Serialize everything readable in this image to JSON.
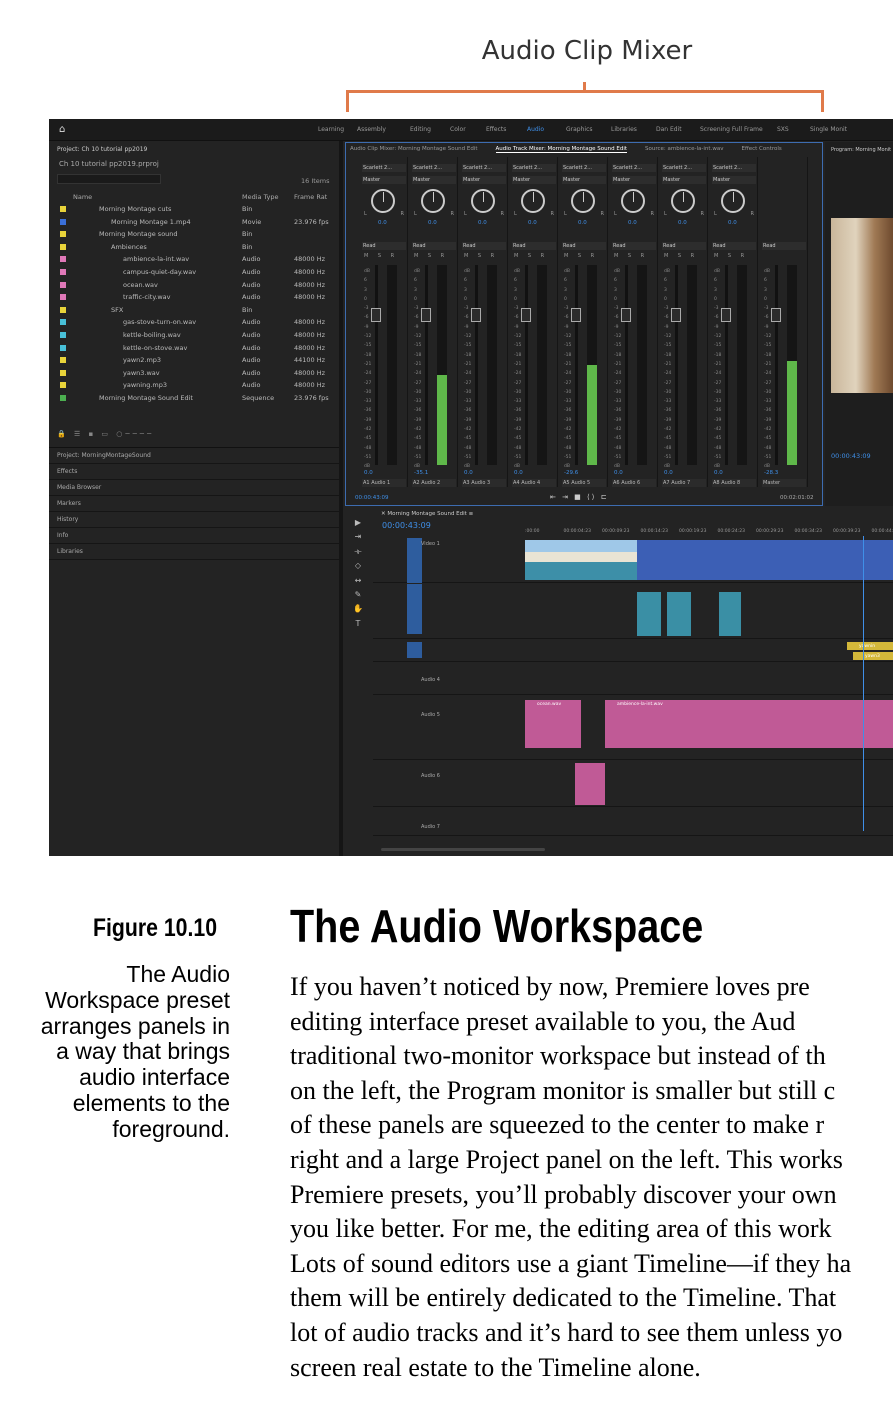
{
  "callout": {
    "title": "Audio Clip Mixer"
  },
  "app": {
    "workspaces": [
      "Learning",
      "Assembly",
      "Editing",
      "Color",
      "Effects",
      "Audio",
      "Graphics",
      "Libraries",
      "Dan Edit",
      "Screening Full Frame",
      "SXS",
      "Single Monit"
    ],
    "active_workspace": "Audio",
    "project": {
      "title": "Project: Ch 10 tutorial pp2019",
      "file": "Ch 10 tutorial pp2019.prproj",
      "item_count": "16 Items",
      "columns": [
        "Name",
        "Media Type",
        "Frame Rat"
      ],
      "rows": [
        {
          "name": "Morning Montage cuts",
          "type": "Bin",
          "rate": "",
          "color": "#e8d33a"
        },
        {
          "name": "Morning Montage 1.mp4",
          "type": "Movie",
          "rate": "23.976 fps",
          "color": "#3a6fd8"
        },
        {
          "name": "Morning Montage sound",
          "type": "Bin",
          "rate": "",
          "color": "#e8d33a"
        },
        {
          "name": "Ambiences",
          "type": "Bin",
          "rate": "",
          "color": "#e8d33a"
        },
        {
          "name": "ambience-la-int.wav",
          "type": "Audio",
          "rate": "48000 Hz",
          "color": "#e078b8"
        },
        {
          "name": "campus-quiet-day.wav",
          "type": "Audio",
          "rate": "48000 Hz",
          "color": "#e078b8"
        },
        {
          "name": "ocean.wav",
          "type": "Audio",
          "rate": "48000 Hz",
          "color": "#e078b8"
        },
        {
          "name": "traffic-city.wav",
          "type": "Audio",
          "rate": "48000 Hz",
          "color": "#e078b8"
        },
        {
          "name": "SFX",
          "type": "Bin",
          "rate": "",
          "color": "#e8d33a"
        },
        {
          "name": "gas-stove-turn-on.wav",
          "type": "Audio",
          "rate": "48000 Hz",
          "color": "#48c0d8"
        },
        {
          "name": "kettle-boiling.wav",
          "type": "Audio",
          "rate": "48000 Hz",
          "color": "#48c0d8"
        },
        {
          "name": "kettle-on-stove.wav",
          "type": "Audio",
          "rate": "48000 Hz",
          "color": "#48c0d8"
        },
        {
          "name": "yawn2.mp3",
          "type": "Audio",
          "rate": "44100 Hz",
          "color": "#e8d33a"
        },
        {
          "name": "yawn3.wav",
          "type": "Audio",
          "rate": "48000 Hz",
          "color": "#e8d33a"
        },
        {
          "name": "yawning.mp3",
          "type": "Audio",
          "rate": "48000 Hz",
          "color": "#e8d33a"
        },
        {
          "name": "Morning Montage Sound Edit",
          "type": "Sequence",
          "rate": "23.976 fps",
          "color": "#4caf50"
        }
      ]
    },
    "lower_panels": [
      "Project: MorningMontageSound",
      "Effects",
      "Media Browser",
      "Markers",
      "History",
      "Info",
      "Libraries"
    ],
    "mixer": {
      "tabs": [
        "Audio Clip Mixer: Morning Montage Sound Edit",
        "Audio Track Mixer: Morning Montage Sound Edit",
        "Source: ambience-la-int.wav",
        "Effect Controls"
      ],
      "active_tab": "Audio Track Mixer: Morning Montage Sound Edit",
      "channels": [
        {
          "name": "Scarlett 2...",
          "master": "Master",
          "pan": "0.0",
          "read": "Read",
          "vol": "0.0",
          "track": "A1",
          "track_name": "Audio 1",
          "level": 0
        },
        {
          "name": "Scarlett 2...",
          "master": "Master",
          "pan": "0.0",
          "read": "Read",
          "vol": "-35.1",
          "track": "A2",
          "track_name": "Audio 2",
          "level": 0.45
        },
        {
          "name": "Scarlett 2...",
          "master": "Master",
          "pan": "0.0",
          "read": "Read",
          "vol": "0.0",
          "track": "A3",
          "track_name": "Audio 3",
          "level": 0
        },
        {
          "name": "Scarlett 2...",
          "master": "Master",
          "pan": "0.0",
          "read": "Read",
          "vol": "0.0",
          "track": "A4",
          "track_name": "Audio 4",
          "level": 0
        },
        {
          "name": "Scarlett 2...",
          "master": "Master",
          "pan": "0.0",
          "read": "Read",
          "vol": "-29.6",
          "track": "A5",
          "track_name": "Audio 5",
          "level": 0.5
        },
        {
          "name": "Scarlett 2...",
          "master": "Master",
          "pan": "0.0",
          "read": "Read",
          "vol": "0.0",
          "track": "A6",
          "track_name": "Audio 6",
          "level": 0
        },
        {
          "name": "Scarlett 2...",
          "master": "Master",
          "pan": "0.0",
          "read": "Read",
          "vol": "0.0",
          "track": "A7",
          "track_name": "Audio 7",
          "level": 0
        },
        {
          "name": "Scarlett 2...",
          "master": "Master",
          "pan": "0.0",
          "read": "Read",
          "vol": "0.0",
          "track": "A8",
          "track_name": "Audio 8",
          "level": 0
        },
        {
          "name": "",
          "master": "",
          "pan": "",
          "read": "Read",
          "vol": "-28.3",
          "track": "",
          "track_name": "Master",
          "level": 0.52
        }
      ],
      "timecode_start": "00:00:43:09",
      "timecode_end": "00:02:01:02"
    },
    "program": {
      "title": "Program: Morning Monit",
      "timecode": "00:00:43:09"
    },
    "timeline": {
      "sequence": "Morning Montage Sound Edit",
      "timecode": "00:00:43:09",
      "ruler": [
        ":00:00",
        "00:00:04:23",
        "00:00:09:23",
        "00:00:14:23",
        "00:00:19:23",
        "00:00:24:23",
        "00:00:29:23",
        "00:00:34:23",
        "00:00:39:23",
        "00:00:44:22"
      ],
      "tracks": [
        "Video 1",
        "",
        "Audio 4",
        "Audio 5",
        "Audio 6",
        "Audio 7"
      ],
      "track_ids": [
        "V1",
        "A1",
        "A2",
        "A3",
        "A4",
        "A5",
        "A6",
        "A7"
      ],
      "clips": [
        "ocean.wav",
        "ambience-la-int.wav",
        "yawnin",
        "yawn3"
      ]
    }
  },
  "figure": {
    "number": "Figure 10.10",
    "caption_lines": [
      "The Audio",
      "Workspace preset",
      "arranges panels in",
      "a way that brings",
      "audio interface",
      "elements to the",
      "foreground."
    ]
  },
  "section": {
    "heading": "The Audio Workspace",
    "lines": [
      "If you haven’t noticed by now, Premiere loves pre",
      "editing interface preset available to you, the Aud",
      "traditional two-monitor workspace but instead of th",
      "on the left, the Program monitor is smaller but still c",
      "of these panels are squeezed to the center to make r",
      "right and a large Project panel on the left. This works",
      "Premiere presets, you’ll probably discover your own",
      "you like better. For me, the editing area of this work",
      "Lots of sound editors use a giant Timeline—if they ha",
      "them will be entirely dedicated to the Timeline. That",
      "lot of audio tracks and it’s hard to see them unless yo",
      "screen real estate to the Timeline alone."
    ]
  }
}
